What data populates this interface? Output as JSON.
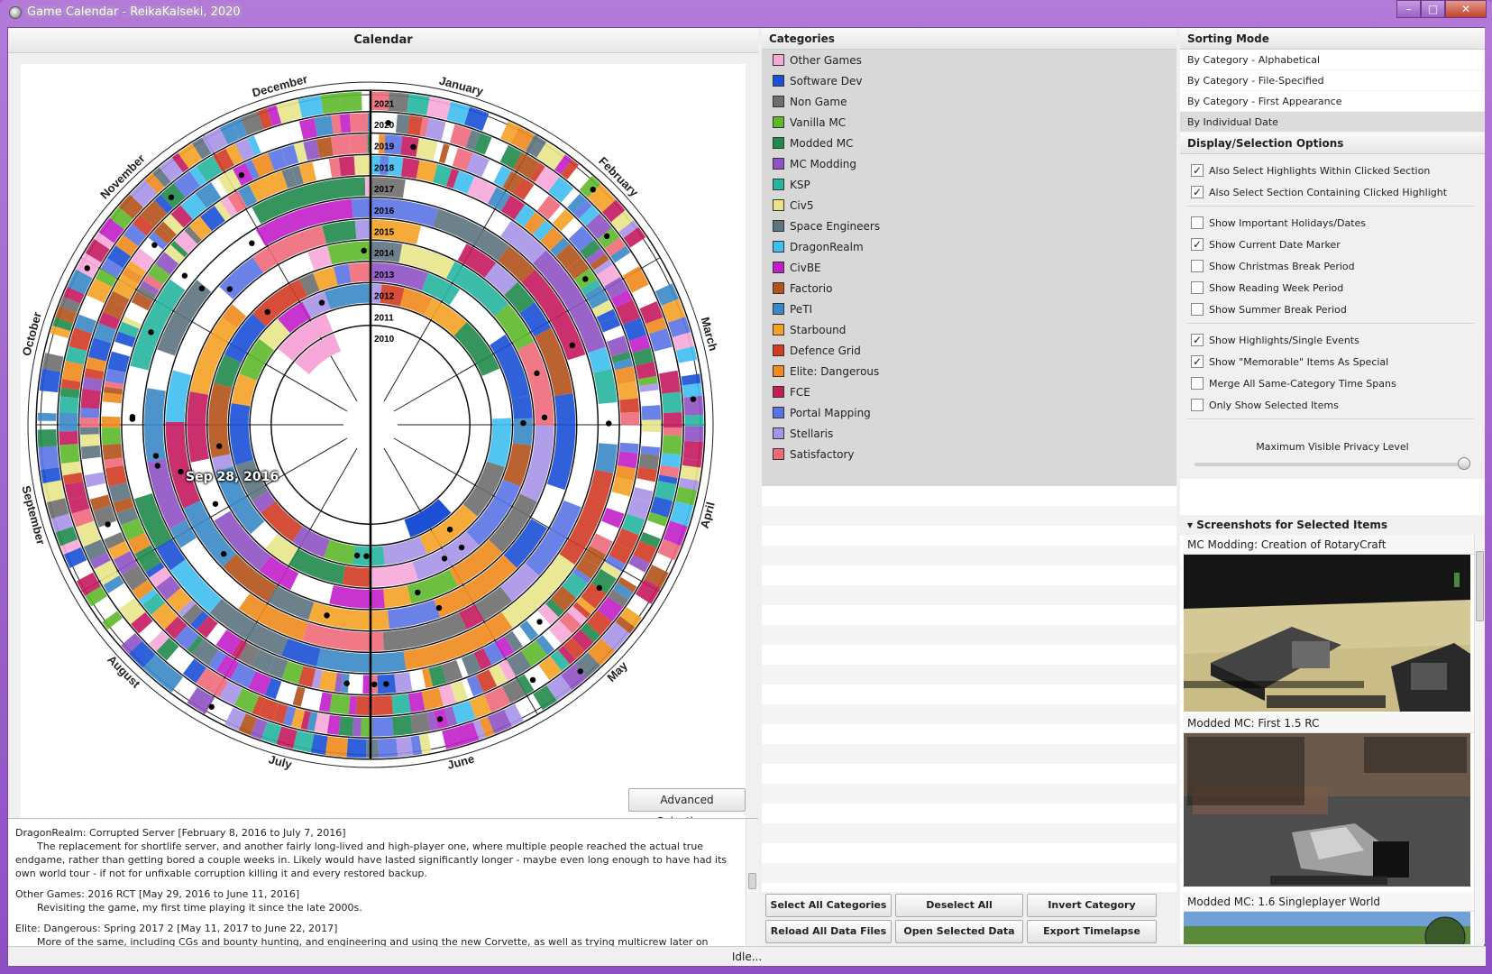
{
  "window": {
    "title": "Game Calendar - ReikaKalseki, 2020",
    "controls": {
      "minimize": "–",
      "maximize": "□",
      "close": "✕"
    }
  },
  "calendar": {
    "header": "Calendar",
    "months": [
      "January",
      "February",
      "March",
      "April",
      "May",
      "June",
      "July",
      "August",
      "September",
      "October",
      "November",
      "December"
    ],
    "years": [
      "2010",
      "2011",
      "2012",
      "2013",
      "2014",
      "2015",
      "2016",
      "2017",
      "2018",
      "2019",
      "2020",
      "2021"
    ],
    "hover_date": "Sep 28, 2016",
    "advanced_button": "Advanced Selection..."
  },
  "descriptions": [
    {
      "title": "DragonRealm: Corrupted Server [February 8, 2016 to July 7, 2016]",
      "body": "The replacement for shortlife server, and another fairly long-lived and high-player one, where multiple people reached the actual true endgame, rather than getting bored a couple weeks in. Likely would have lasted significantly longer - maybe even long enough to have had its own world tour - if not for unfixable corruption killing it and every restored backup."
    },
    {
      "title": "Other Games: 2016 RCT [May 29, 2016 to June 11, 2016]",
      "body": "Revisiting the game, my first time playing it since the late 2000s."
    },
    {
      "title": "Elite: Dangerous: Spring 2017 2 [May 11, 2017 to June 22, 2017]",
      "body": "More of the same, including CGs and bounty hunting, and engineering and using the new Corvette, as well as trying multicrew later on"
    }
  ],
  "categories": {
    "header": "Categories",
    "items": [
      {
        "name": "Other Games",
        "color": "#f7a8d8"
      },
      {
        "name": "Software Dev",
        "color": "#1a4fd6"
      },
      {
        "name": "Non Game",
        "color": "#6e6e6e"
      },
      {
        "name": "Vanilla MC",
        "color": "#5db82a"
      },
      {
        "name": "Modded MC",
        "color": "#1f8a4a"
      },
      {
        "name": "MC Modding",
        "color": "#8e52c4"
      },
      {
        "name": "KSP",
        "color": "#25b5a0"
      },
      {
        "name": "Civ5",
        "color": "#e8e48a"
      },
      {
        "name": "Space Engineers",
        "color": "#5d7380"
      },
      {
        "name": "DragonRealm",
        "color": "#3fbef0"
      },
      {
        "name": "CivBE",
        "color": "#c21fc9"
      },
      {
        "name": "Factorio",
        "color": "#b3521a"
      },
      {
        "name": "PeTI",
        "color": "#3a88c8"
      },
      {
        "name": "Starbound",
        "color": "#f5a123"
      },
      {
        "name": "Defence Grid",
        "color": "#d23a24"
      },
      {
        "name": "Elite: Dangerous",
        "color": "#f08a1c"
      },
      {
        "name": "FCE",
        "color": "#c41a5e"
      },
      {
        "name": "Portal Mapping",
        "color": "#5a73e6"
      },
      {
        "name": "Stellaris",
        "color": "#a893e8"
      },
      {
        "name": "Satisfactory",
        "color": "#f06a7a"
      }
    ],
    "buttons": {
      "select_all": "Select All Categories",
      "deselect_all": "Deselect All Categories",
      "invert": "Invert Category Selection",
      "reload": "Reload All Data Files",
      "open_selected": "Open Selected Data Files",
      "export_video": "Export Timelapse Video"
    }
  },
  "sorting": {
    "header": "Sorting Mode",
    "modes": [
      {
        "label": "By Category - Alphabetical",
        "selected": false
      },
      {
        "label": "By Category - File-Specified",
        "selected": false
      },
      {
        "label": "By Category - First Appearance",
        "selected": false
      },
      {
        "label": "By Individual Date",
        "selected": true
      }
    ]
  },
  "display_options": {
    "header": "Display/Selection Options",
    "options": [
      {
        "label": "Also Select Highlights Within Clicked Section",
        "checked": true
      },
      {
        "label": "Also Select Section Containing Clicked Highlight",
        "checked": true
      },
      {
        "label": "Show Important Holidays/Dates",
        "checked": false
      },
      {
        "label": "Show Current Date Marker",
        "checked": true
      },
      {
        "label": "Show Christmas Break Period",
        "checked": false
      },
      {
        "label": "Show Reading Week Period",
        "checked": false
      },
      {
        "label": "Show Summer Break Period",
        "checked": false
      },
      {
        "label": "Show Highlights/Single Events",
        "checked": true
      },
      {
        "label": "Show \"Memorable\" Items As Special",
        "checked": true
      },
      {
        "label": "Merge All Same-Category Time Spans",
        "checked": false
      },
      {
        "label": "Only Show Selected Items",
        "checked": false
      }
    ],
    "privacy_label": "Maximum Visible Privacy Level",
    "privacy_level": 1.0
  },
  "screenshots": {
    "header": "Screenshots for Selected Items",
    "items": [
      {
        "label": "MC Modding: Creation of RotaryCraft"
      },
      {
        "label": "Modded MC: First 1.5 RC"
      },
      {
        "label": "Modded MC: 1.6 Singleplayer World"
      }
    ]
  },
  "status": {
    "text": "Idle..."
  }
}
